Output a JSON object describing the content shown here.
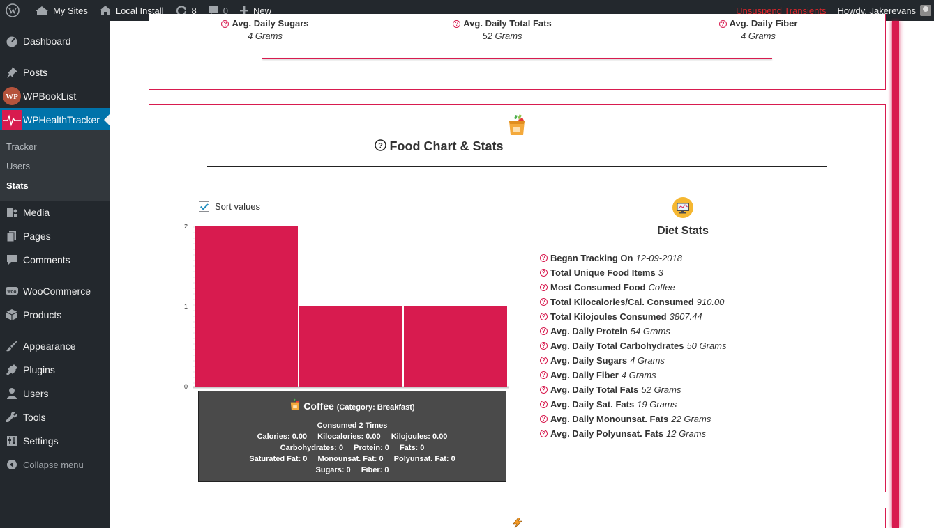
{
  "adminbar": {
    "my_sites": "My Sites",
    "site_name": "Local Install",
    "updates_count": "8",
    "comments_count": "0",
    "new_label": "New",
    "unsuspend": "Unsuspend Transients",
    "howdy": "Howdy, Jakerevans"
  },
  "menu": {
    "dashboard": "Dashboard",
    "posts": "Posts",
    "wpbooklist": "WPBookList",
    "wphealthtracker": "WPHealthTracker",
    "sub": {
      "tracker": "Tracker",
      "users": "Users",
      "stats": "Stats"
    },
    "media": "Media",
    "pages": "Pages",
    "comments": "Comments",
    "woocommerce": "WooCommerce",
    "products": "Products",
    "appearance": "Appearance",
    "plugins": "Plugins",
    "users": "Users",
    "tools": "Tools",
    "settings": "Settings",
    "collapse": "Collapse menu"
  },
  "top_stats": [
    {
      "label": "Avg. Daily Sugars",
      "value": "4 Grams"
    },
    {
      "label": "Avg. Daily Total Fats",
      "value": "52 Grams"
    },
    {
      "label": "Avg. Daily Fiber",
      "value": "4 Grams"
    }
  ],
  "food_section": {
    "title": "Food Chart & Stats",
    "sort_label": "Sort values",
    "sort_checked": true
  },
  "chart_data": {
    "type": "bar",
    "categories": [
      "Coffee",
      "",
      ""
    ],
    "values": [
      2,
      1,
      1
    ],
    "ylim": [
      0,
      2
    ],
    "yticks": [
      "0",
      "1",
      "2"
    ],
    "bar_color": "#d81b4f"
  },
  "tooltip": {
    "name": "Coffee",
    "category": "(Category: Breakfast)",
    "consumed": "Consumed 2 Times",
    "calories": "Calories: 0.00",
    "kilocalories": "Kilocalories: 0.00",
    "kilojoules": "Kilojoules: 0.00",
    "carbohydrates": "Carbohydrates: 0",
    "protein": "Protein: 0",
    "fats": "Fats: 0",
    "saturated": "Saturated Fat: 0",
    "monounsat": "Monounsat. Fat: 0",
    "polyunsat": "Polyunsat. Fat: 0",
    "sugars": "Sugars: 0",
    "fiber": "Fiber: 0"
  },
  "diet_stats": {
    "title": "Diet Stats",
    "rows": [
      {
        "label": "Began Tracking On",
        "value": "12-09-2018"
      },
      {
        "label": "Total Unique Food Items",
        "value": "3"
      },
      {
        "label": "Most Consumed Food",
        "value": "Coffee"
      },
      {
        "label": "Total Kilocalories/Cal. Consumed",
        "value": "910.00"
      },
      {
        "label": "Total Kilojoules Consumed",
        "value": "3807.44"
      },
      {
        "label": "Avg. Daily Protein",
        "value": "54 Grams"
      },
      {
        "label": "Avg. Daily Total Carbohydrates",
        "value": "50 Grams"
      },
      {
        "label": "Avg. Daily Sugars",
        "value": "4 Grams"
      },
      {
        "label": "Avg. Daily Fiber",
        "value": "4 Grams"
      },
      {
        "label": "Avg. Daily Total Fats",
        "value": "52 Grams"
      },
      {
        "label": "Avg. Daily Sat. Fats",
        "value": "19 Grams"
      },
      {
        "label": "Avg. Daily Monounsat. Fats",
        "value": "22 Grams"
      },
      {
        "label": "Avg. Daily Polyunsat. Fats",
        "value": "12 Grams"
      }
    ]
  },
  "colors": {
    "accent": "#d81b4f",
    "admin_dark": "#23282d",
    "admin_blue": "#0073aa"
  }
}
